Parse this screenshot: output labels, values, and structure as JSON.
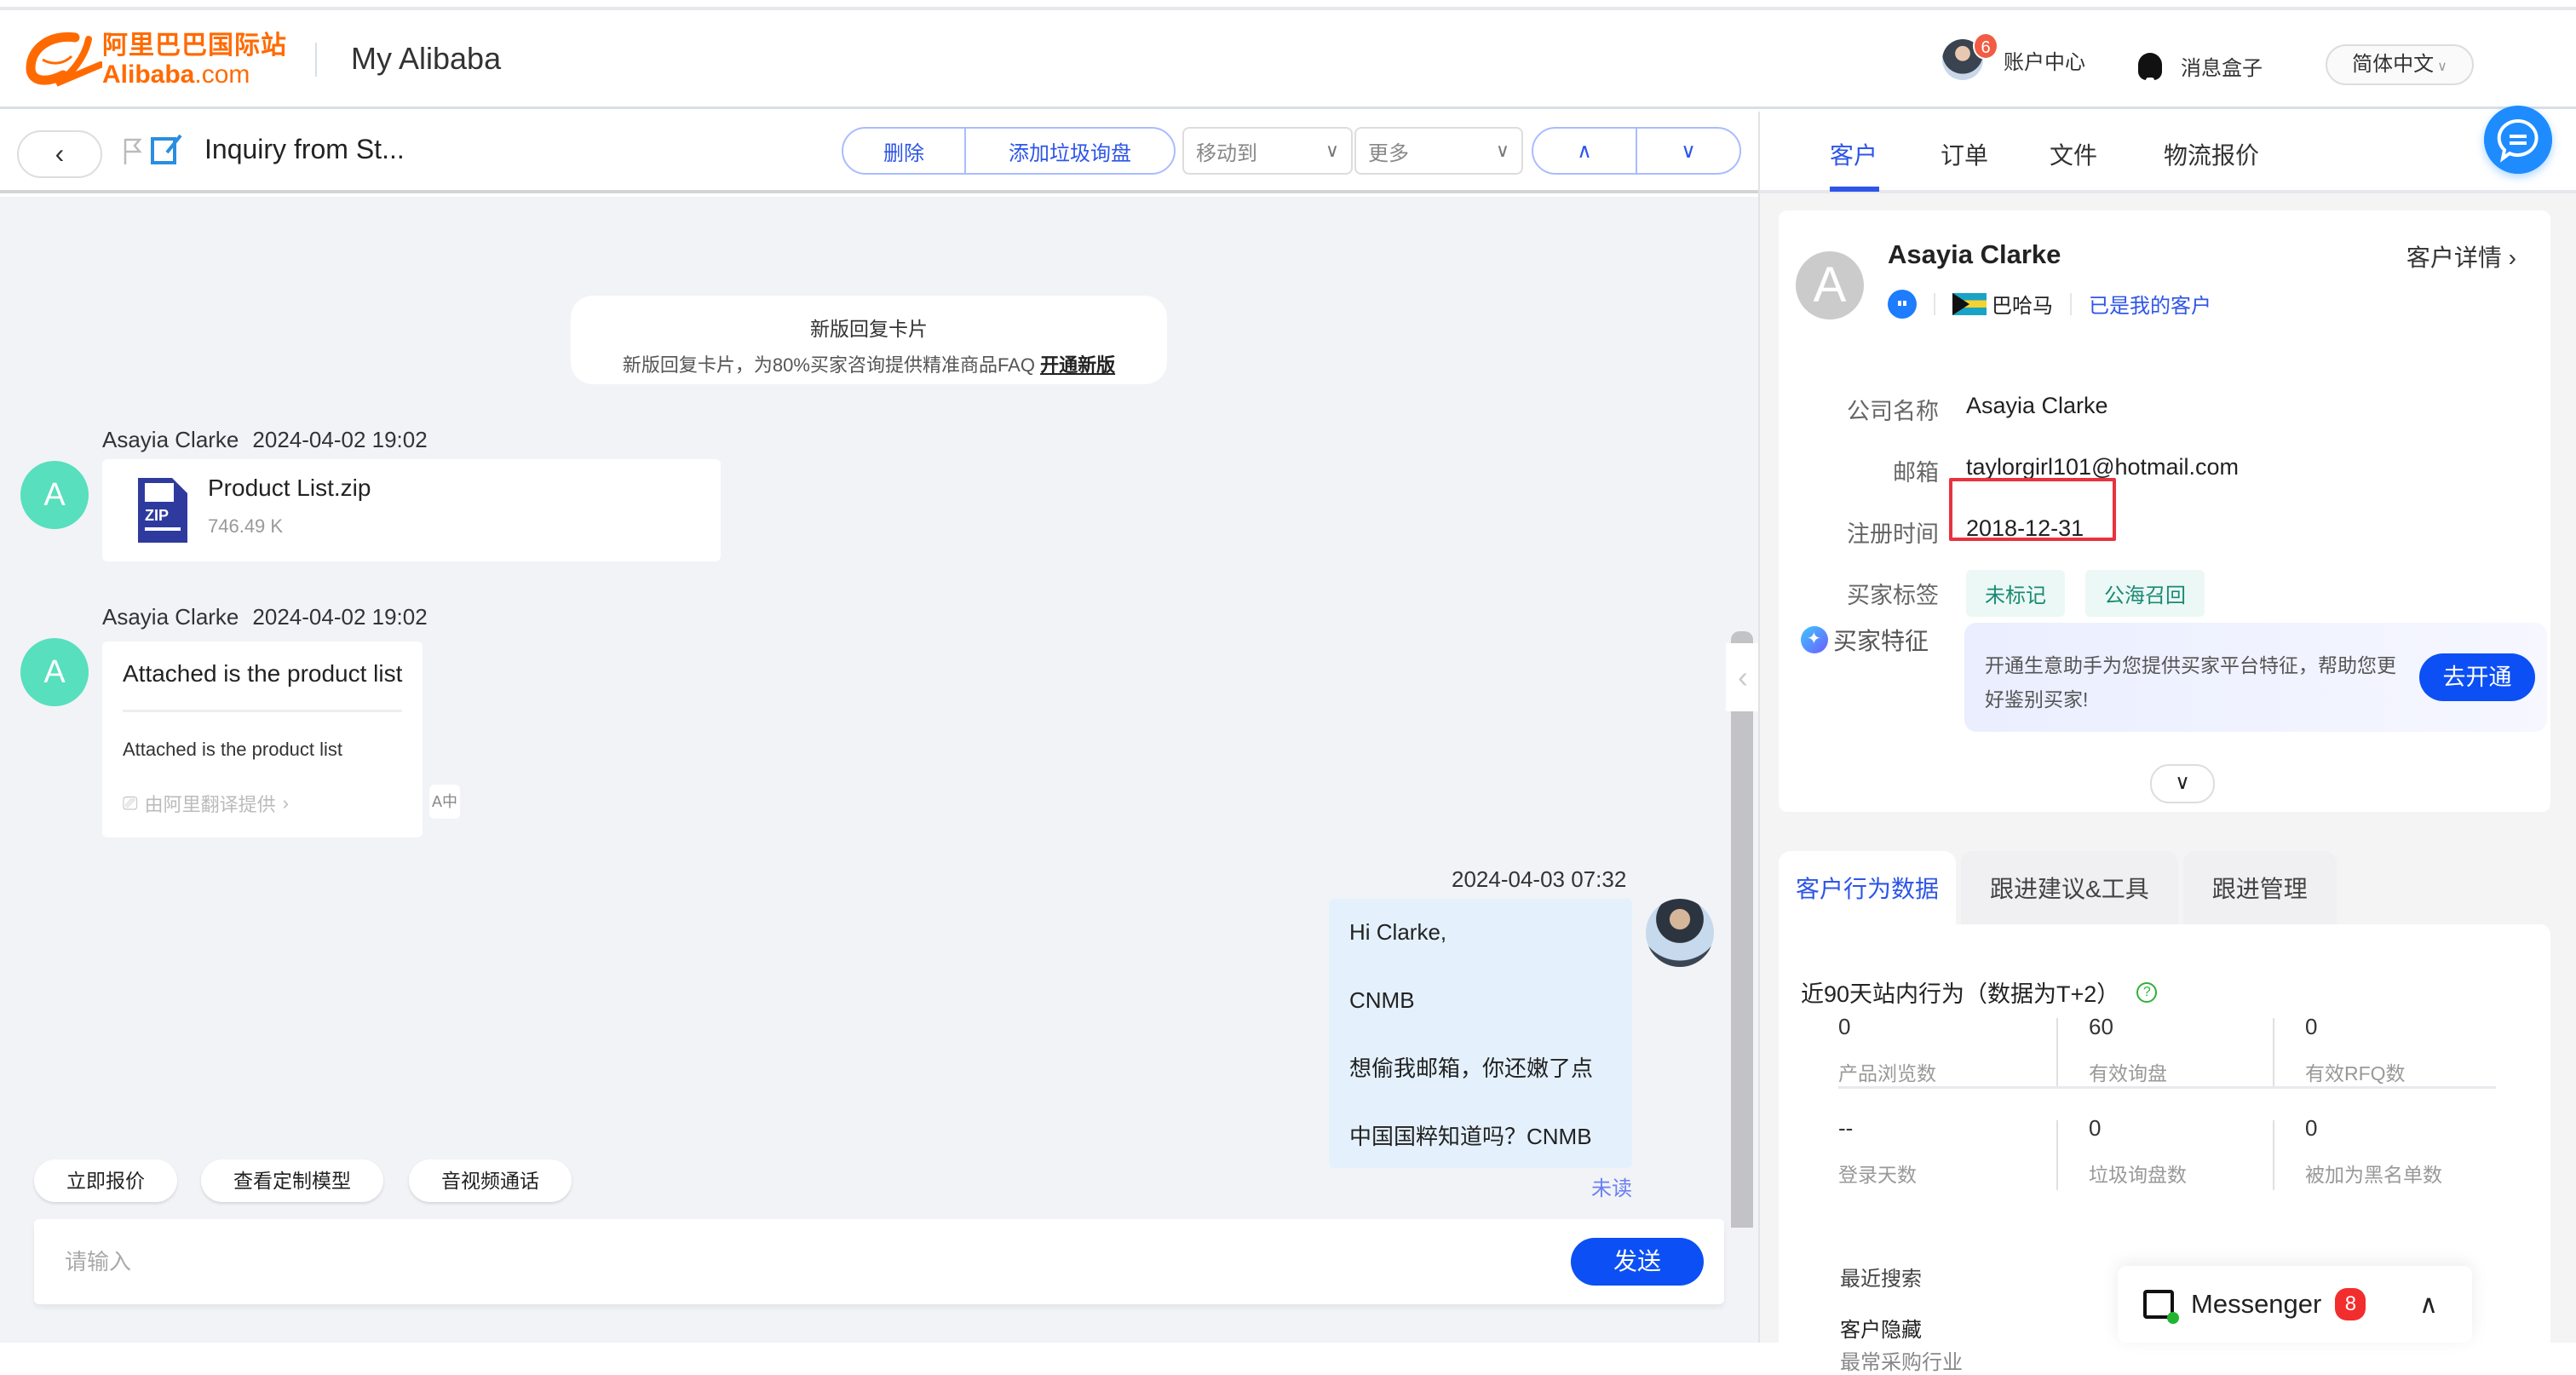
{
  "header": {
    "logo_cn": "阿里巴巴国际站",
    "logo_en_bold": "Alibaba",
    "logo_en_suffix": ".com",
    "app_title": "My Alibaba",
    "account_badge": "6",
    "account_label": "账户中心",
    "messagebox_label": "消息盒子",
    "language": "简体中文"
  },
  "toolbar": {
    "back_icon": "‹",
    "title": "Inquiry from St...",
    "delete_label": "删除",
    "add_spam_label": "添加垃圾询盘",
    "move_to_label": "移动到",
    "more_label": "更多",
    "prev_icon": "∧",
    "next_icon": "∨"
  },
  "chat": {
    "notice": {
      "title": "新版回复卡片",
      "body": "新版回复卡片，为80%买家咨询提供精准商品FAQ",
      "link": "开通新版"
    },
    "messages": [
      {
        "sender": "Asayia Clarke",
        "time": "2024-04-02 19:02",
        "avatar": "A",
        "file": {
          "name": "Product List.zip",
          "size": "746.49 K",
          "type": "ZIP"
        }
      },
      {
        "sender": "Asayia Clarke",
        "time": "2024-04-02 19:02",
        "avatar": "A",
        "text": "Attached is the product list",
        "translation": "Attached is the product list",
        "translated_by": "由阿里翻译提供"
      },
      {
        "time": "2024-04-03 07:32",
        "lines": [
          "Hi Clarke,",
          "CNMB",
          "想偷我邮箱，你还嫩了点",
          "中国国粹知道吗？CNMB"
        ],
        "status": "未读"
      }
    ],
    "quick_actions": [
      "立即报价",
      "查看定制模型",
      "音视频通话"
    ],
    "input_placeholder": "请输入",
    "send_label": "发送"
  },
  "right_panel": {
    "tabs": [
      "客户",
      "订单",
      "文件",
      "物流报价"
    ],
    "active_tab": 0,
    "customer": {
      "avatar": "A",
      "name": "Asayia Clarke",
      "detail_link": "客户详情 ›",
      "country": "巴哈马",
      "relationship": "已是我的客户",
      "fields": [
        {
          "label": "公司名称",
          "value": "Asayia Clarke"
        },
        {
          "label": "邮箱",
          "value": "taylorgirl101@hotmail.com"
        },
        {
          "label": "注册时间",
          "value": "2018-12-31"
        }
      ],
      "tags_label": "买家标签",
      "tags": [
        "未标记",
        "公海召回"
      ],
      "feature_label": "买家特征",
      "feature_text": "开通生意助手为您提供买家平台特征，帮助您更好鉴别买家!",
      "feature_button": "去开通"
    },
    "bottom_tabs": [
      "客户行为数据",
      "跟进建议&工具",
      "跟进管理"
    ],
    "behavior": {
      "title": "近90天站内行为（数据为T+2）",
      "stats": [
        {
          "value": "0",
          "label": "产品浏览数"
        },
        {
          "value": "60",
          "label": "有效询盘"
        },
        {
          "value": "0",
          "label": "有效RFQ数"
        },
        {
          "value": "--",
          "label": "登录天数"
        },
        {
          "value": "0",
          "label": "垃圾询盘数"
        },
        {
          "value": "0",
          "label": "被加为黑名单数"
        }
      ],
      "recent_search_label": "最近搜索",
      "hidden_label": "客户隐藏",
      "industry_label": "最常采购行业"
    }
  },
  "messenger": {
    "label": "Messenger",
    "badge": "8"
  },
  "colors": {
    "brand": "#ff6a00",
    "primary": "#0c4ff5",
    "link": "#2d55e8",
    "avatar_green": "#57dfbe",
    "highlight": "#e8323f"
  }
}
